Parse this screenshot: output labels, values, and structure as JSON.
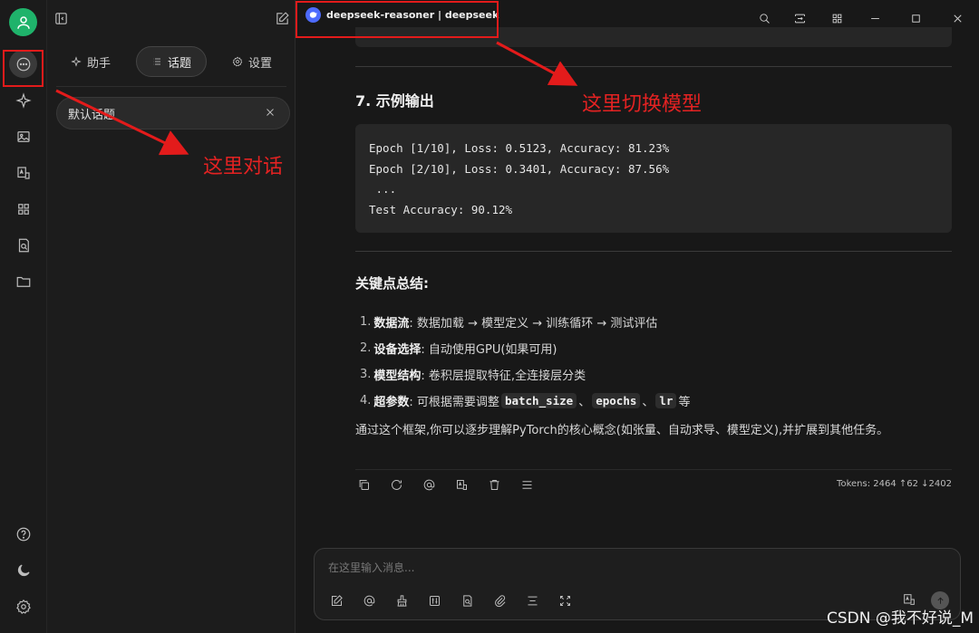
{
  "sidebar": {
    "items": [
      {
        "icon": "chat-icon",
        "active": true
      },
      {
        "icon": "sparkle-icon"
      },
      {
        "icon": "image-icon"
      },
      {
        "icon": "translate-icon"
      },
      {
        "icon": "apps-icon"
      },
      {
        "icon": "doc-search-icon"
      },
      {
        "icon": "folder-icon"
      }
    ],
    "bottom": [
      {
        "icon": "help-icon"
      },
      {
        "icon": "moon-icon"
      },
      {
        "icon": "settings-icon"
      }
    ]
  },
  "panel": {
    "tabs": [
      {
        "label": "助手",
        "icon": "sparkle-icon"
      },
      {
        "label": "话题",
        "icon": "list-icon",
        "active": true
      },
      {
        "label": "设置",
        "icon": "gear-icon"
      }
    ],
    "topic": "默认话题"
  },
  "header": {
    "model_label": "deepseek-reasoner | deepseek",
    "accent_color": "#4d6bfe"
  },
  "content": {
    "section_heading": "7. 示例输出",
    "code_lines": [
      "Epoch [1/10], Loss: 0.5123, Accuracy: 81.23%",
      "Epoch [2/10], Loss: 0.3401, Accuracy: 87.56%",
      " ...",
      "Test Accuracy: 90.12%"
    ],
    "summary_heading": "关键点总结:",
    "list": [
      {
        "num": "1.",
        "bold": "数据流",
        "text": ": 数据加载 → 模型定义 → 训练循环 → 测试评估"
      },
      {
        "num": "2.",
        "bold": "设备选择",
        "text": ": 自动使用GPU(如果可用)"
      },
      {
        "num": "3.",
        "bold": "模型结构",
        "text": ": 卷积层提取特征,全连接层分类"
      },
      {
        "num": "4.",
        "bold": "超参数",
        "text": ": 可根据需要调整",
        "chips": [
          "batch_size",
          "epochs",
          "lr"
        ],
        "sep": "、",
        "tail": "等"
      }
    ],
    "paragraph": "通过这个框架,你可以逐步理解PyTorch的核心概念(如张量、自动求导、模型定义),并扩展到其他任务。",
    "tokens": "Tokens: 2464 ↑62 ↓2402"
  },
  "composer": {
    "placeholder": "在这里输入消息..."
  },
  "annotations": {
    "switch_model": "这里切换模型",
    "dialog": "这里对话",
    "color": "#e31b1b"
  },
  "watermark": "CSDN @我不好说_M"
}
